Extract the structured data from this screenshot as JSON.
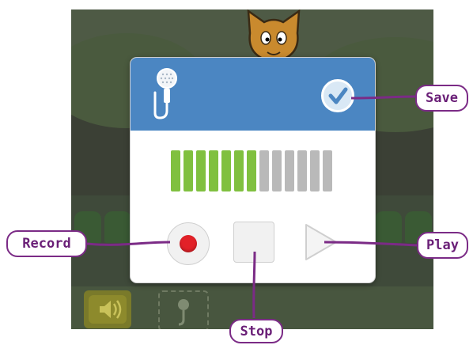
{
  "annotations": {
    "save": "Save",
    "record": "Record",
    "play": "Play",
    "stop": "Stop"
  },
  "recorder": {
    "header_icon": "microphone-icon",
    "save_icon": "checkmark-icon",
    "level_meter": {
      "total_bars": 13,
      "active_bars": 7,
      "active_color": "#80c03f",
      "inactive_color": "#b9b9b9"
    },
    "controls": [
      "record-button",
      "stop-button",
      "play-button"
    ]
  },
  "colors": {
    "header": "#4b86c2",
    "record": "#e22128",
    "callout_border": "#7b2b86",
    "callout_text": "#6a1f77"
  }
}
